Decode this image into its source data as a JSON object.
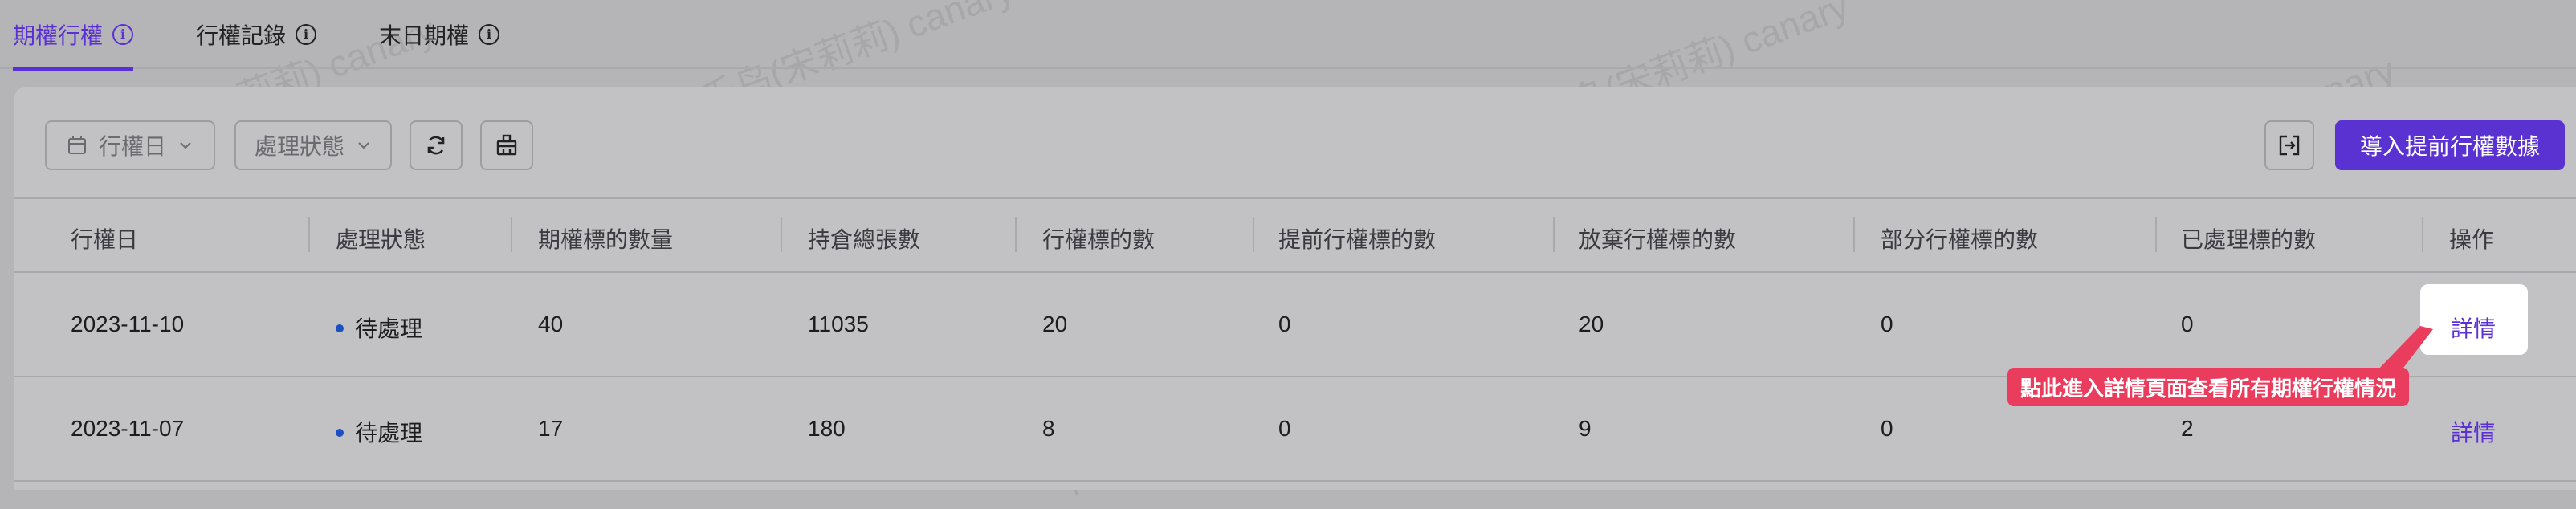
{
  "tabs": [
    {
      "label": "期權行權",
      "active": true
    },
    {
      "label": "行權記錄",
      "active": false
    },
    {
      "label": "末日期權",
      "active": false
    }
  ],
  "toolbar": {
    "date_filter": "行權日",
    "status_filter": "處理狀態",
    "import_button": "導入提前行權數據"
  },
  "table": {
    "headers": [
      "行權日",
      "處理狀態",
      "期權標的數量",
      "持倉總張數",
      "行權標的數",
      "提前行權標的數",
      "放棄行權標的數",
      "部分行權標的數",
      "已處理標的數",
      "操作"
    ],
    "rows": [
      {
        "date": "2023-11-10",
        "status": "待處理",
        "option_count": "40",
        "total_positions": "11035",
        "exercise_count": "20",
        "early_exercise_count": "0",
        "abandon_count": "20",
        "partial_count": "0",
        "processed_count": "0",
        "action": "詳情"
      },
      {
        "date": "2023-11-07",
        "status": "待處理",
        "option_count": "17",
        "total_positions": "180",
        "exercise_count": "8",
        "early_exercise_count": "0",
        "abandon_count": "9",
        "partial_count": "0",
        "processed_count": "2",
        "action": "詳情"
      }
    ]
  },
  "tooltip": "點此進入詳情頁面查看所有期權行權情況",
  "watermark": "千鸟(宋莉莉) canary",
  "colors": {
    "accent": "#5b2fd6",
    "status_dot": "#1c4fbf",
    "tooltip": "#ea3d5e"
  }
}
